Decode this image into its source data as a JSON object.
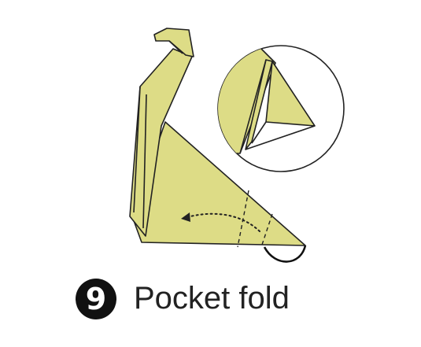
{
  "step": {
    "number": "9",
    "caption": "Pocket fold"
  },
  "colors": {
    "paper": "#dddc86",
    "stroke": "#222222",
    "background": "#ffffff"
  },
  "icons": {
    "arrow": "curved-dotted-arrow",
    "fold": "dashed-fold-line",
    "detail": "zoom-detail-circle"
  }
}
